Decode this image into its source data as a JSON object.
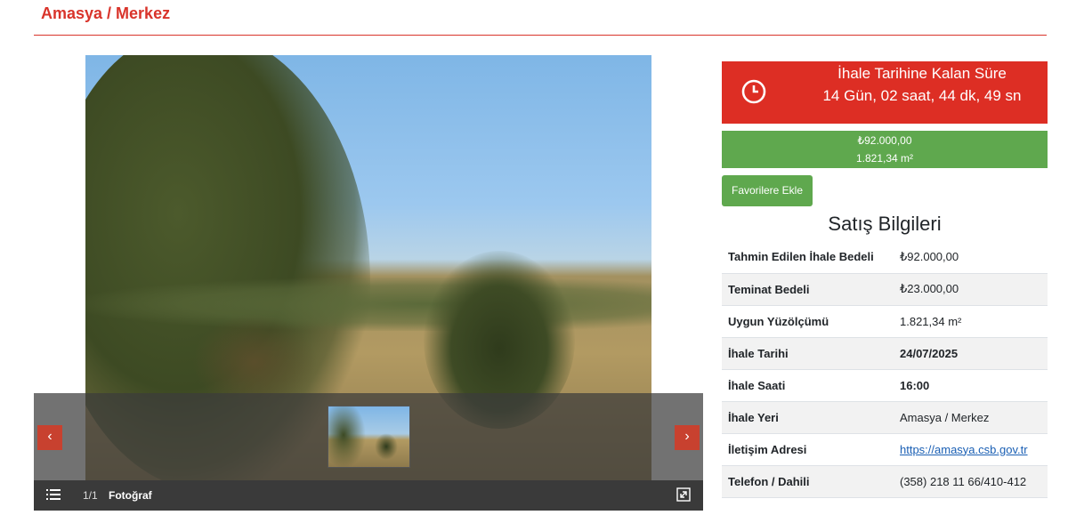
{
  "header": {
    "title": "Amasya / Merkez"
  },
  "gallery": {
    "prev_label": "‹",
    "next_label": "›",
    "counter": "1/1",
    "counter_label": "Fotoğraf",
    "menu_icon": "menu-list-icon",
    "expand_icon": "expand-icon"
  },
  "countdown": {
    "icon": "clock-icon",
    "title": "İhale Tarihine Kalan Süre",
    "value": "14 Gün, 02 saat, 44 dk, 49 sn",
    "bg_color": "#dd2e24"
  },
  "price": {
    "amount": "₺92.000,00",
    "area": "1.821,34 m²",
    "bg_color": "#5fa84e"
  },
  "favorite_button": {
    "label": "Favorilere Ekle"
  },
  "sales_info": {
    "title": "Satış Bilgileri",
    "rows": [
      {
        "key": "Tahmin Edilen İhale Bedeli",
        "value": "₺92.000,00"
      },
      {
        "key": "Teminat Bedeli",
        "value": "₺23.000,00"
      },
      {
        "key": "Uygun Yüzölçümü",
        "value": "1.821,34 m²"
      },
      {
        "key": "İhale Tarihi",
        "value": "24/07/2025"
      },
      {
        "key": "İhale Saati",
        "value": "16:00"
      },
      {
        "key": "İhale Yeri",
        "value": "Amasya / Merkez"
      },
      {
        "key": "İletişim Adresi",
        "value": "https://amasya.csb.gov.tr"
      },
      {
        "key": "Telefon / Dahili",
        "value": "(358) 218 11 66/410-412"
      }
    ]
  }
}
